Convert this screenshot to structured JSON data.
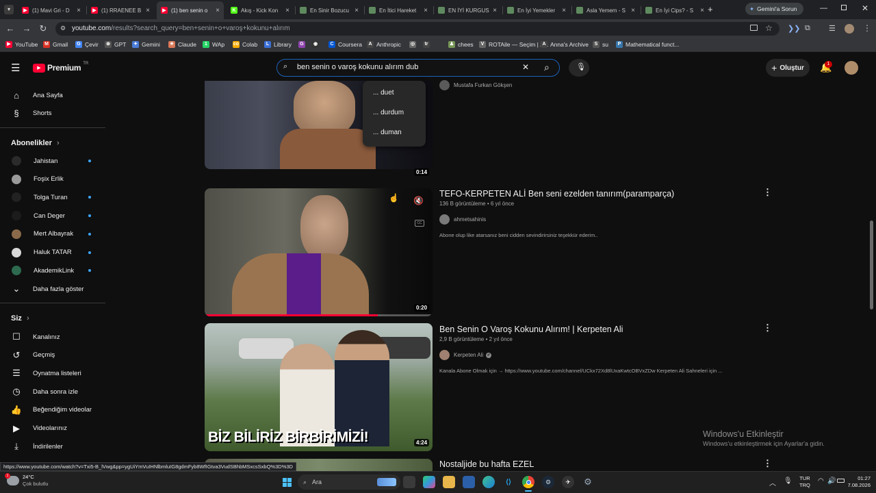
{
  "browser": {
    "tabs": [
      {
        "title": "(1) Mavi Gri - D",
        "color": "#ff0033",
        "letter": "▶"
      },
      {
        "title": "(1) RRAENEE B",
        "color": "#ff0033",
        "letter": "▶"
      },
      {
        "title": "(1) ben senin o",
        "color": "#ff0033",
        "letter": "▶",
        "active": true
      },
      {
        "title": "Akış - Kick Kon",
        "color": "#53fc18",
        "letter": "K"
      },
      {
        "title": "En Sinir Bozucu",
        "color": "#5f8a5f",
        "letter": ""
      },
      {
        "title": "En İtici Hareket",
        "color": "#5f8a5f",
        "letter": ""
      },
      {
        "title": "EN İYİ KURGUS",
        "color": "#5f8a5f",
        "letter": ""
      },
      {
        "title": "En İyi Yemekler",
        "color": "#5f8a5f",
        "letter": ""
      },
      {
        "title": "Asla Yemem - S",
        "color": "#5f8a5f",
        "letter": ""
      },
      {
        "title": "En İyi Cips? - S",
        "color": "#5f8a5f",
        "letter": ""
      }
    ],
    "gemini_button": "Gemini'a Sorun",
    "url_host": "youtube.com",
    "url_path": "/results?search_query=ben+senin+o+varoş+kokunu+alırım",
    "bookmarks": [
      {
        "label": "YouTube",
        "color": "#ff0033",
        "letter": "▶"
      },
      {
        "label": "Gmail",
        "color": "#d93025",
        "letter": "M"
      },
      {
        "label": "Çevir",
        "color": "#4285f4",
        "letter": "G"
      },
      {
        "label": "GPT",
        "color": "#555555",
        "letter": "⊛"
      },
      {
        "label": "Gemini",
        "color": "#4a7bd6",
        "letter": "✦"
      },
      {
        "label": "Claude",
        "color": "#d97757",
        "letter": "✳"
      },
      {
        "label": "WAp",
        "color": "#25d366",
        "letter": "1"
      },
      {
        "label": "Colab",
        "color": "#f9ab00",
        "letter": "co"
      },
      {
        "label": "Library",
        "color": "#3b6fd6",
        "letter": "L"
      },
      {
        "label": "",
        "color": "#8e44ad",
        "letter": "G"
      },
      {
        "label": "",
        "color": "#333333",
        "letter": "◉"
      },
      {
        "label": "Coursera",
        "color": "#0056d2",
        "letter": "C"
      },
      {
        "label": "Anthropic",
        "color": "#444444",
        "letter": "A"
      },
      {
        "label": "",
        "color": "#666666",
        "letter": "◎"
      },
      {
        "label": "",
        "color": "#444444",
        "letter": "tr"
      },
      {
        "label": "chees",
        "color": "#769656",
        "letter": "♟"
      },
      {
        "label": "ROTAile — Seçim | Z...",
        "color": "#666666",
        "letter": "V"
      },
      {
        "label": "Anna's Archive",
        "color": "#444444",
        "letter": "A"
      },
      {
        "label": "su",
        "color": "#555555",
        "letter": "S"
      },
      {
        "label": "Mathematical funct...",
        "color": "#3776ab",
        "letter": "P"
      }
    ]
  },
  "youtube": {
    "logo_text": "Premium",
    "logo_badge": "TR",
    "search_value": "ben senin o varoş kokunu alırım dub",
    "create_label": "Oluştur",
    "notification_count": "1",
    "suggestions": [
      "... duet",
      "... durdum",
      "... duman"
    ],
    "sidebar": {
      "top": [
        {
          "label": "Ana Sayfa",
          "icon": "home-icon"
        },
        {
          "label": "Shorts",
          "icon": "shorts-icon"
        }
      ],
      "subs_heading": "Abonelikler",
      "subs": [
        {
          "label": "Jahistan",
          "color": "#2b2b2b",
          "dot": true
        },
        {
          "label": "Foşix Erlik",
          "color": "#9a9a9a",
          "dot": false
        },
        {
          "label": "Tolga Turan",
          "color": "#222222",
          "dot": true
        },
        {
          "label": "Can Deger",
          "color": "#1c1c1c",
          "dot": true
        },
        {
          "label": "Mert Albayrak",
          "color": "#8a6a4a",
          "dot": true
        },
        {
          "label": "Haluk TATAR",
          "color": "#d8d8d8",
          "dot": true
        },
        {
          "label": "AkademikLink",
          "color": "#2d6a4f",
          "dot": true
        }
      ],
      "show_more": "Daha fazla göster",
      "you_heading": "Siz",
      "you_items": [
        {
          "label": "Kanalınız",
          "icon": "channel-icon"
        },
        {
          "label": "Geçmiş",
          "icon": "history-icon"
        },
        {
          "label": "Oynatma listeleri",
          "icon": "playlist-icon"
        },
        {
          "label": "Daha sonra izle",
          "icon": "clock-icon"
        },
        {
          "label": "Beğendiğim videolar",
          "icon": "like-icon"
        },
        {
          "label": "Videolarınız",
          "icon": "video-icon"
        },
        {
          "label": "İndirilenler",
          "icon": "download-icon"
        }
      ]
    },
    "videos": [
      {
        "title": "",
        "channel": "Mustafa Furkan Gökşen",
        "duration": "0:14"
      },
      {
        "title": "TEFO-KERPETEN ALİ Ben seni ezelden tanırım(paramparça)",
        "views": "136 B görüntüleme",
        "age": "6 yıl önce",
        "channel": "ahmetsahinis",
        "description": "Abone olup like atarsanız beni cidden sevindirirsiniz teşekkür ederim..",
        "duration": "0:20",
        "progress": 0.76
      },
      {
        "title": "Ben Senin O Varoş Kokunu Alırım! | Kerpeten Ali",
        "views": "2,9 B görüntüleme",
        "age": "2 yıl önce",
        "channel": "Kerpeten Ali",
        "verified": "✔",
        "description": "Kanala Abone Olmak için → https://www.youtube.com/channel/UCkx72Xd8lUxaKwtcOBVxZDw Kerpeten Ali Sahneleri için ...",
        "duration": "4:24",
        "overlay_text": "BİZ BİLİRİZ BİRBİRİMİZİ!"
      },
      {
        "title": "Nostaljide bu hafta EZEL"
      }
    ]
  },
  "status_url": "https://www.youtube.com/watch?v=Txi5-B_lVwg&pp=ygUiYmVuIHNlbmluIG8gdmFyb8WfIGtva3VudSBhbMSxcsSxbQ%3D%3D",
  "windows": {
    "activate_title": "Windows'u Etkinleştir",
    "activate_sub": "Windows'u etkinleştirmek için Ayarlar'a gidin.",
    "weather_temp": "24°C",
    "weather_desc": "Çok bulutlu",
    "search_label": "Ara",
    "lang_top": "TUR",
    "lang_bottom": "TRQ",
    "time": "01:27",
    "date": "7.08.2026"
  }
}
